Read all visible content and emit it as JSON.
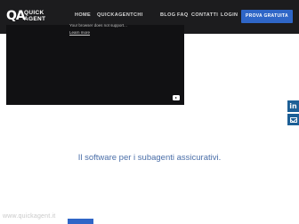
{
  "header": {
    "logo_text_line1": "QUICK",
    "logo_text_line2": "AGENT",
    "nav": {
      "home": "HOME",
      "quickagent": "QUICKAGENT",
      "chi": "CHI",
      "blog": "BLOG",
      "faq": "FAQ",
      "contatti": "CONTATTI",
      "login": "LOGIN"
    },
    "cta_label": "PROVA GRATUITA"
  },
  "video": {
    "message": "Your browser does not support...",
    "learn_more": "Learn more"
  },
  "hero": {
    "tagline": "Il software per i subagenti assicurativi."
  },
  "watermark": "www.quickagent.it",
  "colors": {
    "header_bg": "#1c1c1e",
    "accent": "#2f66c7",
    "social_bg": "#1d5f96",
    "tagline": "#4a6ea8"
  },
  "icons": {
    "social_1": "linkedin-icon",
    "social_2": "email-icon",
    "video": "youtube-icon"
  }
}
